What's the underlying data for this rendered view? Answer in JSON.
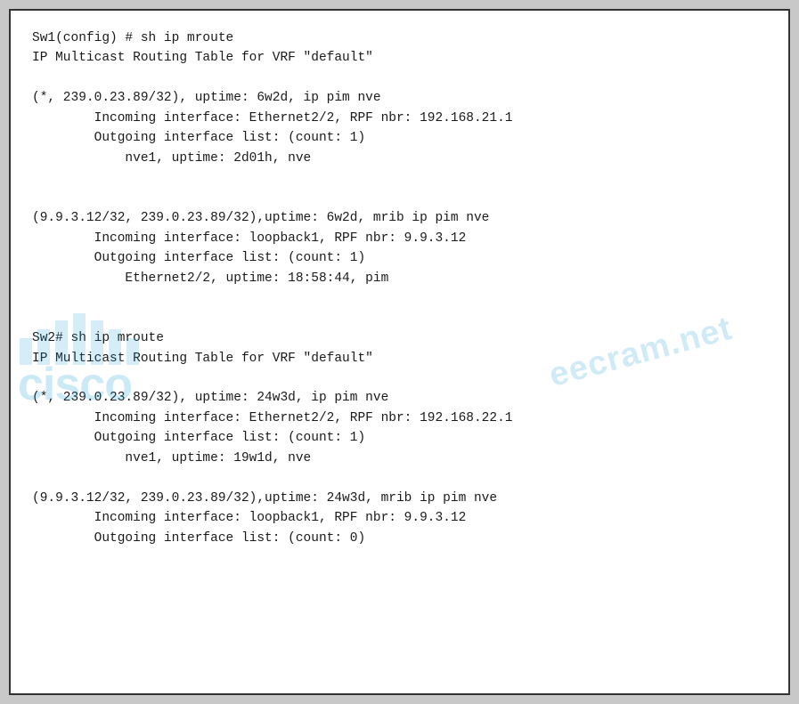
{
  "terminal": {
    "lines": [
      "Sw1(config) # sh ip mroute",
      "IP Multicast Routing Table for VRF \"default\"",
      "",
      "(*, 239.0.23.89/32), uptime: 6w2d, ip pim nve",
      "        Incoming interface: Ethernet2/2, RPF nbr: 192.168.21.1",
      "        Outgoing interface list: (count: 1)",
      "            nve1, uptime: 2d01h, nve",
      "",
      "",
      "(9.9.3.12/32, 239.0.23.89/32),uptime: 6w2d, mrib ip pim nve",
      "        Incoming interface: loopback1, RPF nbr: 9.9.3.12",
      "        Outgoing interface list: (count: 1)",
      "            Ethernet2/2, uptime: 18:58:44, pim",
      "",
      "",
      "Sw2# sh ip mroute",
      "IP Multicast Routing Table for VRF \"default\"",
      "",
      "(*, 239.0.23.89/32), uptime: 24w3d, ip pim nve",
      "        Incoming interface: Ethernet2/2, RPF nbr: 192.168.22.1",
      "        Outgoing interface list: (count: 1)",
      "            nve1, uptime: 19w1d, nve",
      "",
      "(9.9.3.12/32, 239.0.23.89/32),uptime: 24w3d, mrib ip pim nve",
      "        Incoming interface: loopback1, RPF nbr: 9.9.3.12",
      "        Outgoing interface list: (count: 0)"
    ]
  },
  "watermark": {
    "cisco_text": "cisco",
    "ecram_text": "eecram.net"
  }
}
